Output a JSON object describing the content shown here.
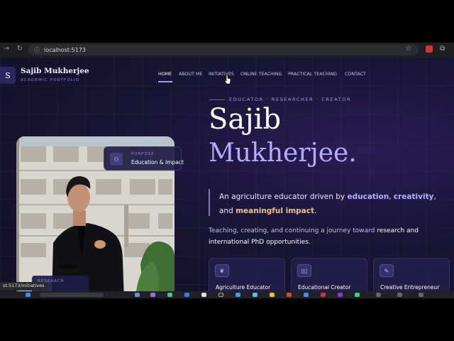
{
  "browser": {
    "url": "localhost:5173",
    "status_url": "st:5173/initiatives"
  },
  "site": {
    "logo_letter": "S",
    "brand_name": "Sajib Mukherjee",
    "brand_sub": "ACADEMIC PORTFOLIO",
    "nav": [
      {
        "label": "HOME"
      },
      {
        "label": "ABOUT ME"
      },
      {
        "label": "INITIATIVES"
      },
      {
        "label": "ONLINE TEACHING"
      },
      {
        "label": "PRACTICAL TEACHING"
      },
      {
        "label": "CONTACT"
      }
    ],
    "tagline": "EDUCATOR · RESEARCHER · CREATOR",
    "title_line1": "Sajib",
    "title_line2": "Mukherjee.",
    "quote": {
      "p1": "An agriculture educator driven by ",
      "h1": "education",
      "p2": ", ",
      "h2": "creativity",
      "p3": ",",
      "p4": "and ",
      "h3": "meaningful impact",
      "p5": "."
    },
    "desc": {
      "p1": "Teaching, creating, and continuing a journey toward ",
      "w1": "research and",
      "w2": "international PhD opportunities",
      "p2": "."
    },
    "pill": {
      "sub": "PURPOSE",
      "main": "Education & Impact"
    },
    "mini_card_sub": "RESEARCH",
    "cards": [
      {
        "label": "Agriculture Educator",
        "icon": "sprout-icon"
      },
      {
        "label": "Educational Creator",
        "icon": "book-icon"
      },
      {
        "label": "Creative Entrepreneur",
        "icon": "feather-icon"
      }
    ]
  },
  "colors": {
    "accent": "#b3abff",
    "highlight_orange": "#f2c08a",
    "background": "#191535"
  }
}
